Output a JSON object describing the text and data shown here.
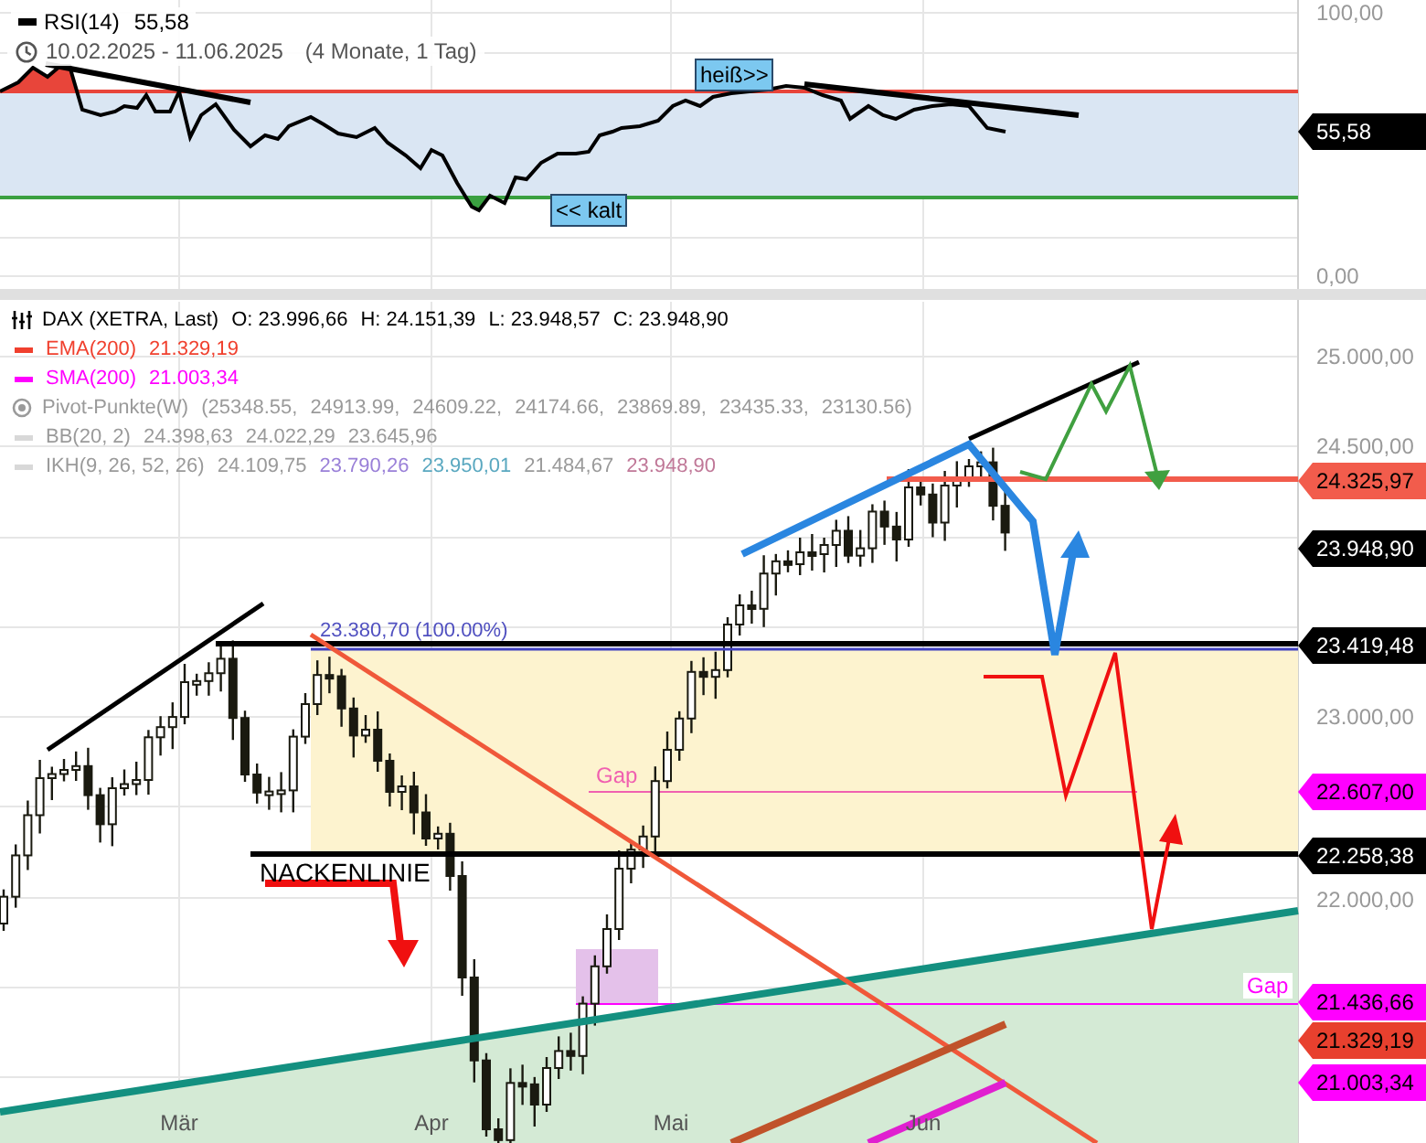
{
  "rsi_panel": {
    "legend": {
      "label": "RSI(14)",
      "value": "55,58"
    },
    "range": {
      "dates": "10.02.2025 - 11.06.2025",
      "span": "(4 Monate, 1 Tag)"
    },
    "labels": [
      {
        "text": "heiß>>"
      },
      {
        "text": "<< kalt"
      }
    ],
    "axis_ticks": [
      "100,00",
      "0,00"
    ],
    "price_tag": "55,58"
  },
  "price_panel": {
    "legend": [
      {
        "kind": "ohlc",
        "name": "DAX (XETRA, Last)",
        "values": [
          {
            "text": "O: 23.996,66"
          },
          {
            "text": "H: 24.151,39"
          },
          {
            "text": "L: 23.948,57"
          },
          {
            "text": "C: 23.948,90"
          }
        ],
        "faded": false
      },
      {
        "kind": "line",
        "name": "EMA(200)",
        "color": "#f0402e",
        "values": [
          {
            "text": "21.329,19"
          }
        ],
        "faded": false
      },
      {
        "kind": "line",
        "name": "SMA(200)",
        "color": "#ff00ff",
        "values": [
          {
            "text": "21.003,34"
          }
        ],
        "faded": false
      },
      {
        "kind": "pivot",
        "name": "Pivot-Punkte(W)",
        "values": [
          {
            "text": "(25348.55,"
          },
          {
            "text": "24913.99,"
          },
          {
            "text": "24609.22,"
          },
          {
            "text": "24174.66,"
          },
          {
            "text": "23869.89,"
          },
          {
            "text": "23435.33,"
          },
          {
            "text": "23130.56)"
          }
        ],
        "faded": true
      },
      {
        "kind": "line",
        "name": "BB(20, 2)",
        "values": [
          {
            "text": "24.398,63"
          },
          {
            "text": "24.022,29"
          },
          {
            "text": "23.645,96"
          }
        ],
        "faded": true
      },
      {
        "kind": "line",
        "name": "IKH(9, 26, 52, 26)",
        "values": [
          {
            "text": "24.109,75"
          },
          {
            "text": "23.790,26",
            "color": "#9a80d8"
          },
          {
            "text": "23.950,01",
            "color": "#5aa8c0"
          },
          {
            "text": "21.484,67"
          },
          {
            "text": "23.948,90",
            "color": "#c07898"
          }
        ],
        "faded": true
      }
    ],
    "annotations": [
      {
        "kind": "level",
        "text": "23.380,70 (100.00%)"
      },
      {
        "kind": "neckline",
        "text": "NACKENLINIE"
      },
      {
        "kind": "gap",
        "text": "Gap"
      },
      {
        "kind": "gap-boxed",
        "text": "Gap"
      }
    ],
    "axis_ticks": [
      "25.000,00",
      "24.500,00",
      "23.000,00",
      "22.000,00"
    ],
    "price_tags": [
      {
        "text": "24.325,97",
        "color": "#f25c4c"
      },
      {
        "text": "23.948,90",
        "color": "#000000"
      },
      {
        "text": "23.419,48",
        "color": "#000000"
      },
      {
        "text": "22.607,00",
        "color": "#ff00ff"
      },
      {
        "text": "22.258,38",
        "color": "#000000"
      },
      {
        "text": "21.436,66",
        "color": "#ff00ff"
      },
      {
        "text": "21.329,19",
        "color": "#e8402e"
      },
      {
        "text": "21.003,34",
        "color": "#ff00ff"
      }
    ],
    "x_ticks": [
      "Mär",
      "Apr",
      "Mai",
      "Jun"
    ]
  }
}
